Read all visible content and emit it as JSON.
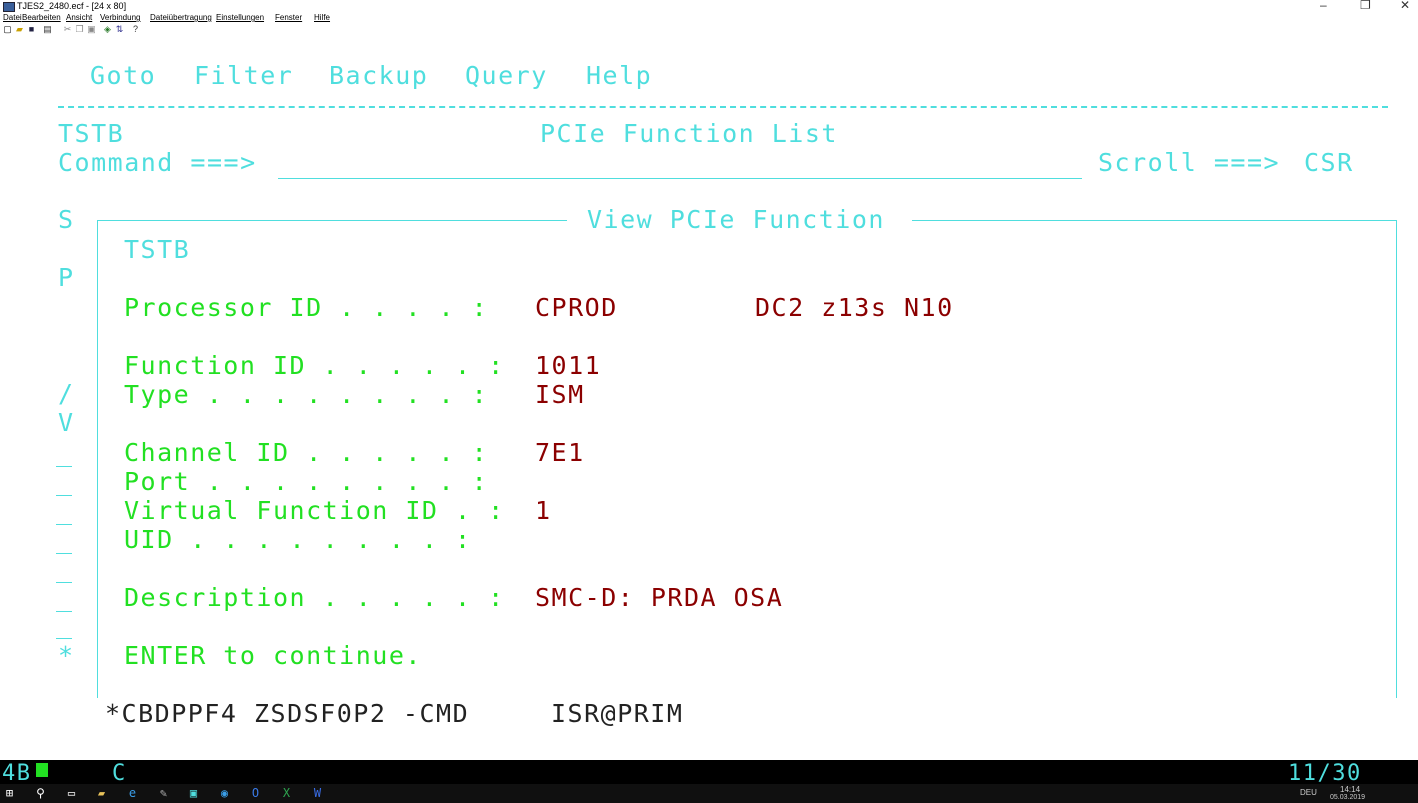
{
  "window": {
    "title": "TJES2_2480.ecf - [24 x 80]",
    "controls": {
      "minimize": "–",
      "restore": "❐",
      "close": "✕"
    }
  },
  "menubar": [
    "Datei",
    "Bearbeiten",
    "Ansicht",
    "Verbindung",
    "Dateiübertragung",
    "Einstellungen",
    "Fenster",
    "Hilfe"
  ],
  "toolbar_icons": [
    "new-icon",
    "open-icon",
    "save-icon",
    "print-icon",
    "cut-icon",
    "copy-icon",
    "paste-icon",
    "macro-icon",
    "transfer-icon",
    "help-icon"
  ],
  "terminal": {
    "action_bar": [
      "Goto",
      "Filter",
      "Backup",
      "Query",
      "Help"
    ],
    "system": "TSTB",
    "screen_title": "PCIe Function List",
    "command_label": "Command ===>",
    "command_value": "",
    "scroll_label": "Scroll ===>",
    "scroll_value": "CSR",
    "left_chars": [
      "S",
      "P",
      "/",
      "V",
      "*"
    ],
    "popup": {
      "title": "View PCIe Function",
      "system": "TSTB",
      "processor_label": "Processor ID . . . . :",
      "processor_id": "CPROD",
      "processor_desc": "DC2 z13s N10",
      "function_label": "Function ID . . . . . :",
      "function_id": "1011",
      "type_label": "Type . . . . . . . . :",
      "type": "ISM",
      "channel_label": "Channel ID . . . . . :",
      "channel_id": "7E1",
      "port_label": "Port . . . . . . . . :",
      "port": "",
      "vf_label": "Virtual Function ID . :",
      "vf_id": "1",
      "uid_label": "UID . . . . . . . . :",
      "uid": "",
      "desc_label": "Description . . . . . :",
      "description": "SMC-D: PRDA OSA",
      "footer": "ENTER to continue."
    },
    "bottom_line_1": "*CBDPPF4 ZSDSF0P2 -CMD",
    "bottom_line_2": "ISR@PRIM"
  },
  "status": {
    "left": "4B",
    "mid": "C",
    "cursor_pos": "11/30"
  },
  "taskbar": {
    "tray_lang": "DEU",
    "time": "14:14",
    "date": "05.03.2019",
    "icons": [
      "windows-icon",
      "search-icon",
      "task-view-icon",
      "file-explorer-icon",
      "edge-icon",
      "paint-icon",
      "terminal-icon",
      "chrome-icon",
      "outlook-icon",
      "excel-icon",
      "word-icon"
    ]
  },
  "colors": {
    "cyan": "#4fdede",
    "green": "#22e022",
    "red": "#8b0000",
    "black": "#000000"
  }
}
